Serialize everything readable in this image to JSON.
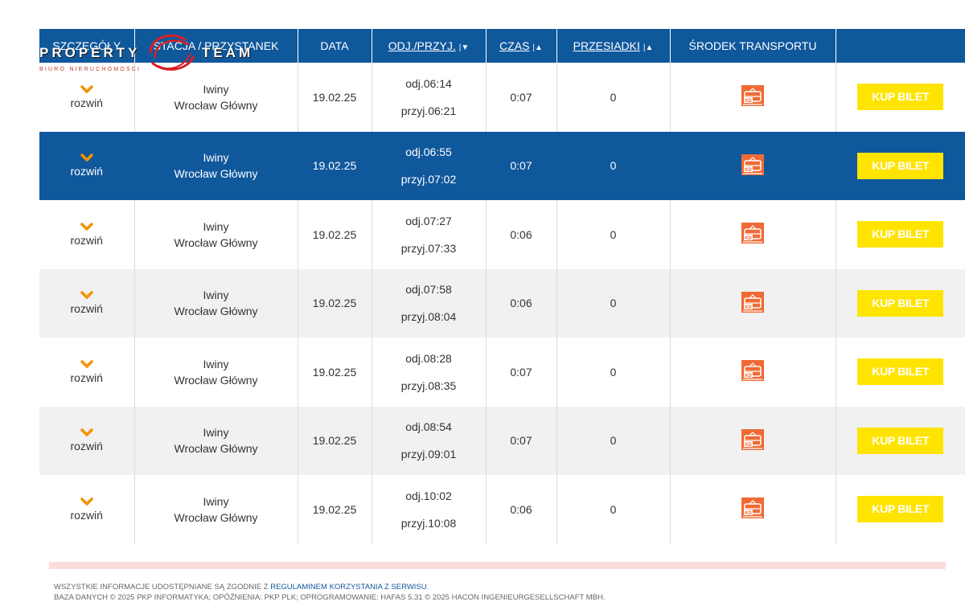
{
  "logo": {
    "word_left": "PROPERTY",
    "word_right": "TEAM",
    "subtitle": "BIURO NIERUCHOMOŚCI"
  },
  "table": {
    "headers": {
      "details": "SZCZEGÓŁY",
      "station": "STACJA / PRZYSTANEK",
      "date": "DATA",
      "dep_arr": "ODJ./PRZYJ.",
      "duration": "CZAS",
      "transfers": "PRZESIADKI",
      "transport": "ŚRODEK TRANSPORTU"
    },
    "rows": [
      {
        "expand": "rozwiń",
        "from": "Iwiny",
        "to": "Wrocław Główny",
        "date": "19.02.25",
        "dep": "odj.06:14",
        "arr": "przyj.06:21",
        "duration": "0:07",
        "transfers": "0",
        "buy": "KUP BILET"
      },
      {
        "expand": "rozwiń",
        "from": "Iwiny",
        "to": "Wrocław Główny",
        "date": "19.02.25",
        "dep": "odj.06:55",
        "arr": "przyj.07:02",
        "duration": "0:07",
        "transfers": "0",
        "buy": "KUP BILET"
      },
      {
        "expand": "rozwiń",
        "from": "Iwiny",
        "to": "Wrocław Główny",
        "date": "19.02.25",
        "dep": "odj.07:27",
        "arr": "przyj.07:33",
        "duration": "0:06",
        "transfers": "0",
        "buy": "KUP BILET"
      },
      {
        "expand": "rozwiń",
        "from": "Iwiny",
        "to": "Wrocław Główny",
        "date": "19.02.25",
        "dep": "odj.07:58",
        "arr": "przyj.08:04",
        "duration": "0:06",
        "transfers": "0",
        "buy": "KUP BILET"
      },
      {
        "expand": "rozwiń",
        "from": "Iwiny",
        "to": "Wrocław Główny",
        "date": "19.02.25",
        "dep": "odj.08:28",
        "arr": "przyj.08:35",
        "duration": "0:07",
        "transfers": "0",
        "buy": "KUP BILET"
      },
      {
        "expand": "rozwiń",
        "from": "Iwiny",
        "to": "Wrocław Główny",
        "date": "19.02.25",
        "dep": "odj.08:54",
        "arr": "przyj.09:01",
        "duration": "0:07",
        "transfers": "0",
        "buy": "KUP BILET"
      },
      {
        "expand": "rozwiń",
        "from": "Iwiny",
        "to": "Wrocław Główny",
        "date": "19.02.25",
        "dep": "odj.10:02",
        "arr": "przyj.10:08",
        "duration": "0:06",
        "transfers": "0",
        "buy": "KUP BILET"
      }
    ]
  },
  "footer": {
    "line1_prefix": "WSZYSTKIE INFORMACJE UDOSTĘPNIANE SĄ ZGODNIE Z ",
    "line1_link": "REGULAMINEM KORZYSTANIA Z SERWISU",
    "line1_suffix": ".",
    "line2": "BAZA DANYCH © 2025 PKP INFORMATYKA; OPÓŹNIENIA: PKP PLK; OPROGRAMOWANIE: HAFAS 5.31 © 2025 HACON INGENIEURGESELLSCHAFT MBH."
  },
  "colors": {
    "header_bg": "#10589c",
    "accent_orange": "#f39200",
    "buy_button": "#ffe400",
    "train_icon": "#f06a35",
    "zebra": "#f1f1f1"
  },
  "icons": {
    "expand": "chevron-down-icon",
    "sort_desc": "caret-down-icon",
    "sort_both": "sort-icon",
    "transport": "train-icon"
  }
}
